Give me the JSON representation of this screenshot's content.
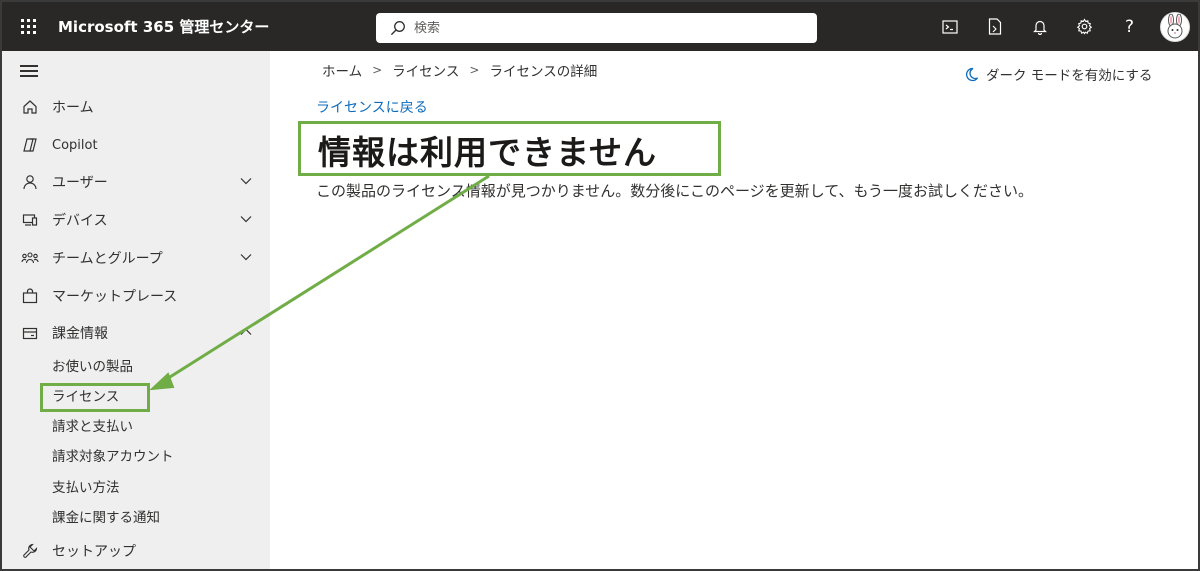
{
  "app": {
    "title": "Microsoft 365 管理センター"
  },
  "search": {
    "placeholder": "検索"
  },
  "topbar": {
    "icons": [
      "terminal-icon",
      "document-icon",
      "bell-icon",
      "gear-icon",
      "help-icon",
      "avatar"
    ],
    "help_label": "?"
  },
  "sidebar": {
    "items": [
      {
        "label": "ホーム",
        "icon": "home-icon"
      },
      {
        "label": "Copilot",
        "icon": "copilot-icon"
      },
      {
        "label": "ユーザー",
        "icon": "user-icon",
        "expandable": true
      },
      {
        "label": "デバイス",
        "icon": "device-icon",
        "expandable": true
      },
      {
        "label": "チームとグループ",
        "icon": "team-icon",
        "expandable": true
      },
      {
        "label": "マーケットプレース",
        "icon": "bag-icon"
      },
      {
        "label": "課金情報",
        "icon": "card-icon",
        "expanded": true
      },
      {
        "label": "セットアップ",
        "icon": "wrench-icon"
      }
    ],
    "billing_sub": [
      "お使いの製品",
      "ライセンス",
      "請求と支払い",
      "請求対象アカウント",
      "支払い方法",
      "課金に関する通知"
    ]
  },
  "breadcrumb": [
    "ホーム",
    "ライセンス",
    "ライセンスの詳細"
  ],
  "dark_mode_label": "ダーク モードを有効にする",
  "main": {
    "back_link": "ライセンスに戻る",
    "title": "情報は利用できません",
    "description": "この製品のライセンス情報が見つかりません。数分後にこのページを更新して、もう一度お試しください。"
  },
  "colors": {
    "topbar": "#292827",
    "sidebar": "#efefef",
    "link": "#0f6cbd",
    "annotation": "#70ad47"
  }
}
